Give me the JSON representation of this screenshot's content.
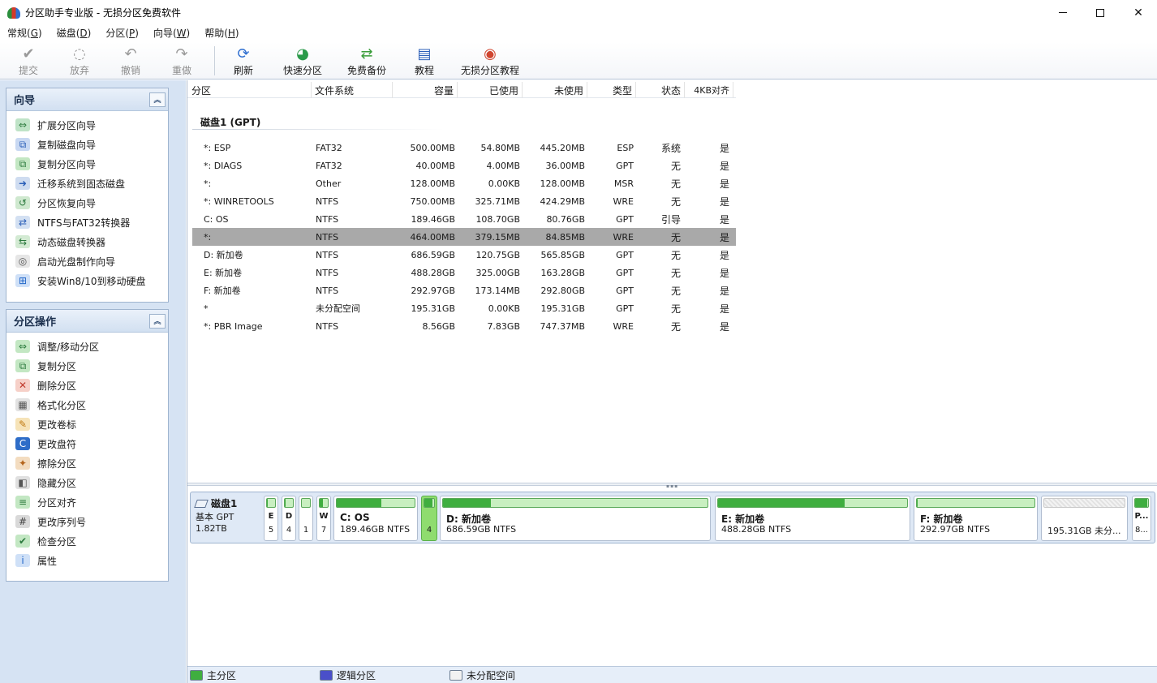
{
  "window": {
    "title": "分区助手专业版 - 无损分区免费软件",
    "controls": {
      "minimize": "—",
      "maximize": "□",
      "close": "✕"
    }
  },
  "menu": [
    {
      "label": "常规(",
      "key": "G",
      "end": ")"
    },
    {
      "label": "磁盘(",
      "key": "D",
      "end": ")"
    },
    {
      "label": "分区(",
      "key": "P",
      "end": ")"
    },
    {
      "label": "向导(",
      "key": "W",
      "end": ")"
    },
    {
      "label": "帮助(",
      "key": "H",
      "end": ")"
    }
  ],
  "toolbar": {
    "commit": "提交",
    "discard": "放弃",
    "undo": "撤销",
    "redo": "重做",
    "refresh": "刷新",
    "quick_partition": "快速分区",
    "free_backup": "免费备份",
    "tutorial": "教程",
    "lossless_tutorial": "无损分区教程"
  },
  "wizards": {
    "title": "向导",
    "items": [
      "扩展分区向导",
      "复制磁盘向导",
      "复制分区向导",
      "迁移系统到固态磁盘",
      "分区恢复向导",
      "NTFS与FAT32转换器",
      "动态磁盘转换器",
      "启动光盘制作向导",
      "安装Win8/10到移动硬盘"
    ]
  },
  "operations": {
    "title": "分区操作",
    "items": [
      "调整/移动分区",
      "复制分区",
      "删除分区",
      "格式化分区",
      "更改卷标",
      "更改盘符",
      "擦除分区",
      "隐藏分区",
      "分区对齐",
      "更改序列号",
      "检查分区",
      "属性"
    ]
  },
  "table": {
    "headers": {
      "partition": "分区",
      "fs": "文件系统",
      "capacity": "容量",
      "used": "已使用",
      "free": "未使用",
      "type": "类型",
      "status": "状态",
      "align": "4KB对齐"
    },
    "disk_label": "磁盘1 (GPT)",
    "rows": [
      {
        "name": "*: ESP",
        "fs": "FAT32",
        "cap": "500.00MB",
        "used": "54.80MB",
        "free": "445.20MB",
        "type": "ESP",
        "status": "系统",
        "align": "是"
      },
      {
        "name": "*: DIAGS",
        "fs": "FAT32",
        "cap": "40.00MB",
        "used": "4.00MB",
        "free": "36.00MB",
        "type": "GPT",
        "status": "无",
        "align": "是"
      },
      {
        "name": "*:",
        "fs": "Other",
        "cap": "128.00MB",
        "used": "0.00KB",
        "free": "128.00MB",
        "type": "MSR",
        "status": "无",
        "align": "是"
      },
      {
        "name": "*: WINRETOOLS",
        "fs": "NTFS",
        "cap": "750.00MB",
        "used": "325.71MB",
        "free": "424.29MB",
        "type": "WRE",
        "status": "无",
        "align": "是"
      },
      {
        "name": "C: OS",
        "fs": "NTFS",
        "cap": "189.46GB",
        "used": "108.70GB",
        "free": "80.76GB",
        "type": "GPT",
        "status": "引导",
        "align": "是"
      },
      {
        "name": "*:",
        "fs": "NTFS",
        "cap": "464.00MB",
        "used": "379.15MB",
        "free": "84.85MB",
        "type": "WRE",
        "status": "无",
        "align": "是"
      },
      {
        "name": "D: 新加卷",
        "fs": "NTFS",
        "cap": "686.59GB",
        "used": "120.75GB",
        "free": "565.85GB",
        "type": "GPT",
        "status": "无",
        "align": "是"
      },
      {
        "name": "E: 新加卷",
        "fs": "NTFS",
        "cap": "488.28GB",
        "used": "325.00GB",
        "free": "163.28GB",
        "type": "GPT",
        "status": "无",
        "align": "是"
      },
      {
        "name": "F: 新加卷",
        "fs": "NTFS",
        "cap": "292.97GB",
        "used": "173.14MB",
        "free": "292.80GB",
        "type": "GPT",
        "status": "无",
        "align": "是"
      },
      {
        "name": "*",
        "fs": "未分配空间",
        "cap": "195.31GB",
        "used": "0.00KB",
        "free": "195.31GB",
        "type": "GPT",
        "status": "无",
        "align": "是"
      },
      {
        "name": "*: PBR Image",
        "fs": "NTFS",
        "cap": "8.56GB",
        "used": "7.83GB",
        "free": "747.37MB",
        "type": "WRE",
        "status": "无",
        "align": "是"
      }
    ]
  },
  "diskmap": {
    "name": "磁盘1",
    "kind": "基本 GPT",
    "size": "1.82TB",
    "parts": [
      {
        "label": "E",
        "sub": "5",
        "used": 0.11
      },
      {
        "label": "D",
        "sub": "4",
        "used": 0.1
      },
      {
        "label": "",
        "sub": "1",
        "used": 0
      },
      {
        "label": "W",
        "sub": "7",
        "used": 0.43
      },
      {
        "label": "C: OS",
        "sub": "189.46GB NTFS",
        "used": 0.57
      },
      {
        "label": "",
        "sub": "4",
        "used": 0.82
      },
      {
        "label": "D: 新加卷",
        "sub": "686.59GB NTFS",
        "used": 0.18
      },
      {
        "label": "E: 新加卷",
        "sub": "488.28GB NTFS",
        "used": 0.67
      },
      {
        "label": "F: 新加卷",
        "sub": "292.97GB NTFS",
        "used": 0.01
      },
      {
        "label": "",
        "sub": "195.31GB 未分...",
        "used": 0
      },
      {
        "label": "P...",
        "sub": "8...",
        "used": 0.91
      }
    ]
  },
  "legend": {
    "primary": "主分区",
    "logical": "逻辑分区",
    "unallocated": "未分配空间"
  },
  "colors": {
    "primary": "#3fae3f",
    "logical": "#4a4fc9",
    "unallocated": "#f2f2f2",
    "selected_row": "#a9a9a9"
  }
}
